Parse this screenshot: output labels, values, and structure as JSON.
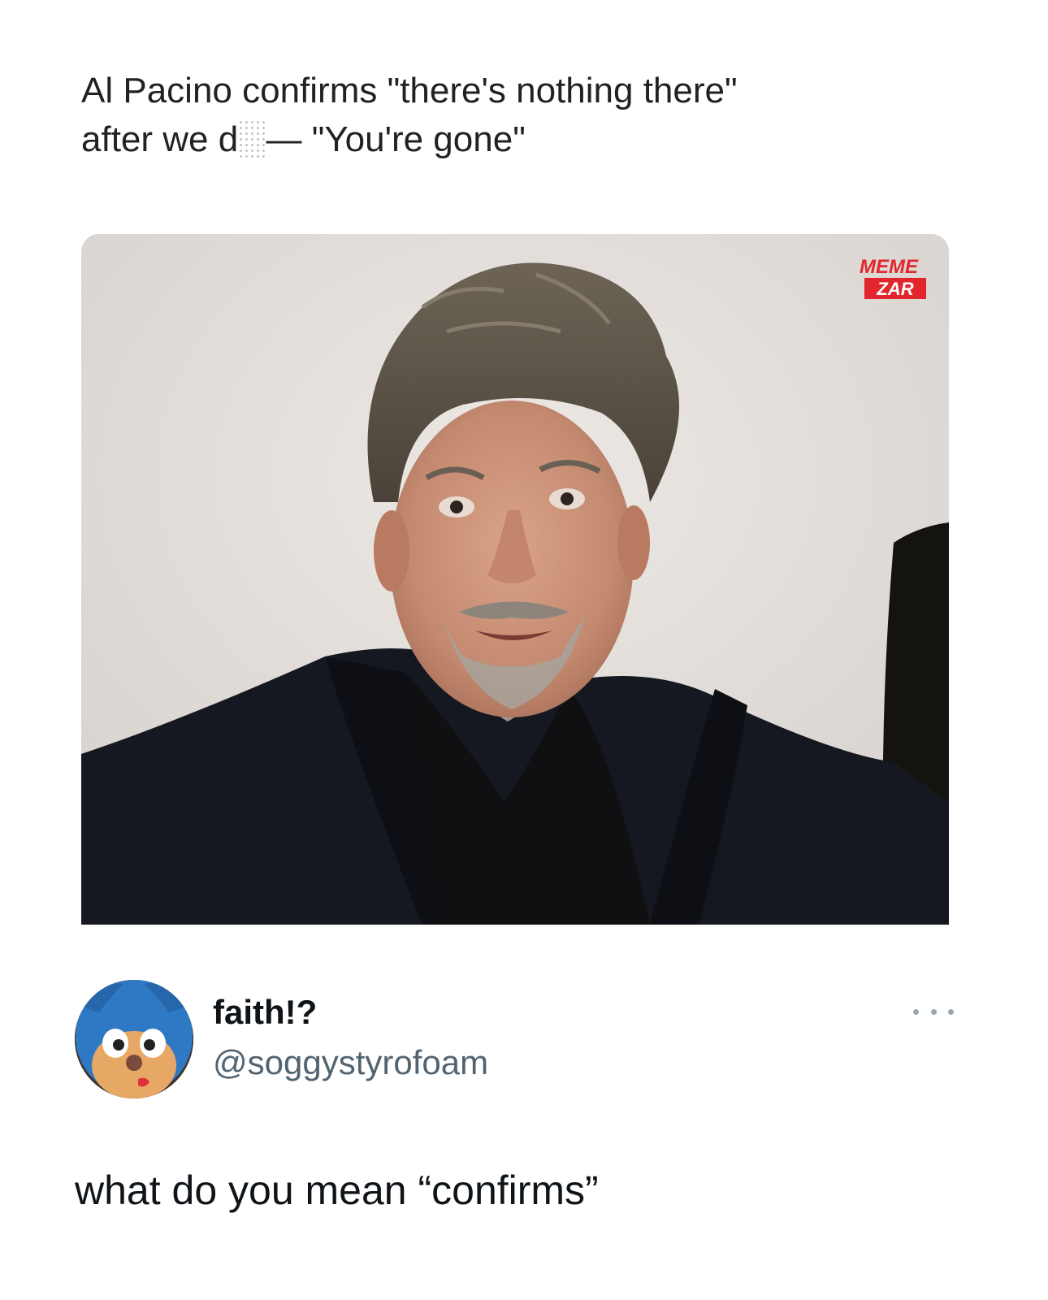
{
  "post": {
    "headline_line1": "Al Pacino confirms \"there's nothing there\"",
    "headline_line2_prefix": "after we d",
    "headline_line2_hidden": "ie",
    "headline_line2_suffix": "— \"You're gone\"",
    "watermark_line1": "MEME",
    "watermark_line2": "ZAR",
    "image_subject": "portrait-photo"
  },
  "reply": {
    "display_name": "faith!?",
    "handle": "@soggystyrofoam",
    "text": "what do you mean “confirms”",
    "avatar_icon": "plush-character-avatar",
    "more_icon": "more-dots-icon"
  },
  "colors": {
    "headline": "#222222",
    "handle": "#536471",
    "text": "#0f1419",
    "watermark_red": "#e3262d"
  }
}
